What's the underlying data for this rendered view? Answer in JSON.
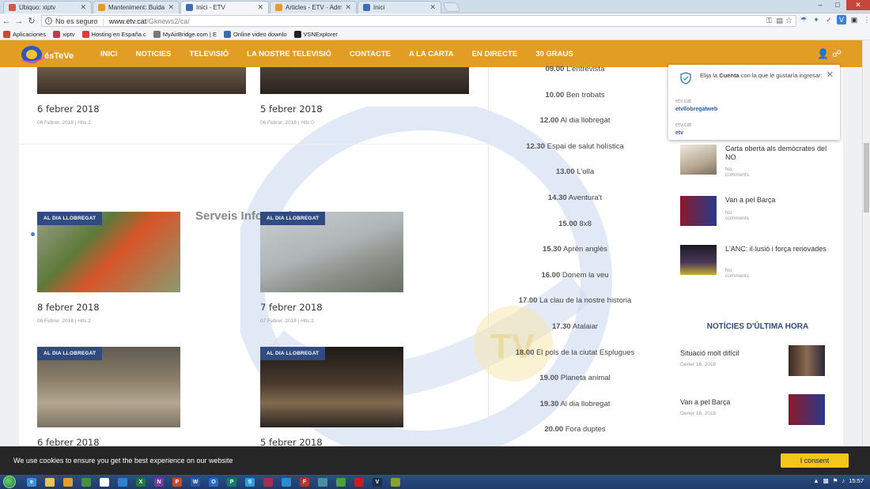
{
  "browser": {
    "tabs": [
      {
        "label": "Ubiquo: xiptv",
        "color": "#d8534a"
      },
      {
        "label": "Manteniment: Buida la m",
        "color": "#e49b2a"
      },
      {
        "label": "Inici - ETV",
        "color": "#3d6fb8",
        "active": true
      },
      {
        "label": "Articles - ETV - Administ",
        "color": "#e49b2a"
      },
      {
        "label": "Inici",
        "color": "#3d6fb8"
      }
    ],
    "security_text": "No es seguro",
    "url_host": "www.etv.cat",
    "url_path": "/Gknews2/ca/",
    "bookmarks": [
      {
        "label": "Aplicaciones",
        "icon": "apps-icon",
        "color": "#c94a3a"
      },
      {
        "label": "xiptv",
        "icon": "xiptv-icon",
        "color": "#c3374a"
      },
      {
        "label": "Hosting en España c",
        "icon": "hosting-icon",
        "color": "#d93d3d"
      },
      {
        "label": "MyAirBridge.com | E",
        "icon": "airbridge-icon",
        "color": "#777"
      },
      {
        "label": "Online video downlo",
        "icon": "video-icon",
        "color": "#3b6ea8"
      },
      {
        "label": "VSNExplorer",
        "icon": "vsn-icon",
        "color": "#222"
      }
    ]
  },
  "site": {
    "brand": "ésTeVe",
    "menu": [
      "INICI",
      "NOTICIES",
      "TELEVISIÓ",
      "LA NOSTRE TELEVISIÓ",
      "CONTACTE",
      "A LA CARTA",
      "EN DIRECTE",
      "30 GRAUS"
    ],
    "top_posts": [
      {
        "title": "6 febrer 2018",
        "meta": "06 Febrer, 2018 | Hits:2"
      },
      {
        "title": "5 febrer 2018",
        "meta": "06 Febrer, 2018 | Hits:0"
      }
    ],
    "section_title": "Serveis Informatius",
    "posts": [
      {
        "badge": "AL DIA LLOBREGAT",
        "title": "8 febrer 2018",
        "meta": "08 Febrer, 2018 | Hits:2"
      },
      {
        "badge": "AL DIA LLOBREGAT",
        "title": "7 febrer 2018",
        "meta": "07 Febrer, 2018 | Hits:2"
      },
      {
        "badge": "AL DIA LLOBREGAT",
        "title": "6 febrer 2018",
        "meta": ""
      },
      {
        "badge": "AL DIA LLOBREGAT",
        "title": "5 febrer 2018",
        "meta": ""
      }
    ],
    "schedule": [
      {
        "time": "09.00",
        "name": "L'entrevista"
      },
      {
        "time": "10.00",
        "name": "Ben trobats"
      },
      {
        "time": "12.00",
        "name": "Al dia llobregat"
      },
      {
        "time": "12.30",
        "name": "Espai de salut holística"
      },
      {
        "time": "13.00",
        "name": "L'olla"
      },
      {
        "time": "14.30",
        "name": "Aventura't"
      },
      {
        "time": "15.00",
        "name": "8x8"
      },
      {
        "time": "15.30",
        "name": "Aprèn anglès"
      },
      {
        "time": "16.00",
        "name": "Donem la veu"
      },
      {
        "time": "17.00",
        "name": "La clau de la nostre historia"
      },
      {
        "time": "17.30",
        "name": "Atalaiar"
      },
      {
        "time": "18.00",
        "name": "El pols de la ciutat Esplugues"
      },
      {
        "time": "19.00",
        "name": "Planeta animal"
      },
      {
        "time": "19.30",
        "name": "Al dia llobregat"
      },
      {
        "time": "20.00",
        "name": "Fora duptes"
      }
    ],
    "sidebar_items": [
      {
        "title": "Carta oberta als demòcrates del NO",
        "comments": "No comments"
      },
      {
        "title": "Van a pel Barça",
        "comments": "No comments"
      },
      {
        "title": "L'ANC: il·lusió i força renovades",
        "comments": "No comments"
      }
    ],
    "latest_heading": "NOTÍCIES D'ÚLTIMA HORA",
    "latest": [
      {
        "title": "Situació molt difícil",
        "date": "Gener 16, 2018"
      },
      {
        "title": "Van a pel Barça",
        "date": "Gener 16, 2018"
      }
    ]
  },
  "account_popup": {
    "text_pre": "Elija la ",
    "text_bold": "Cuenta",
    "text_post": " con la que le gustaría ingresar:",
    "accounts": [
      {
        "host": "etv.cat",
        "user": "etvllobregatweb"
      },
      {
        "host": "etv.cat",
        "user": "etv"
      }
    ]
  },
  "cookie": {
    "message": "We use cookies to ensure you get the best experience on our website",
    "button": "I consent"
  },
  "taskbar": {
    "clock": "15:57",
    "apps": [
      {
        "icon": "ie-icon",
        "color": "#3d8fd6",
        "glyph": "e"
      },
      {
        "icon": "explorer-icon",
        "color": "#e9c15a",
        "glyph": ""
      },
      {
        "icon": "media-icon",
        "color": "#e0a030",
        "glyph": ""
      },
      {
        "icon": "chrome-icon",
        "color": "#4a8f3a",
        "glyph": ""
      },
      {
        "icon": "app-icon",
        "color": "#ffffff",
        "glyph": ""
      },
      {
        "icon": "edge-icon",
        "color": "#2f7fd0",
        "glyph": ""
      },
      {
        "icon": "excel-icon",
        "color": "#1f7a3a",
        "glyph": "X"
      },
      {
        "icon": "onenote-icon",
        "color": "#7b3a9c",
        "glyph": "N"
      },
      {
        "icon": "powerpoint-icon",
        "color": "#c94a2a",
        "glyph": "P"
      },
      {
        "icon": "word-icon",
        "color": "#2b5aa8",
        "glyph": "W"
      },
      {
        "icon": "outlook-icon",
        "color": "#2a6ac2",
        "glyph": "O"
      },
      {
        "icon": "publisher-icon",
        "color": "#177a6a",
        "glyph": "P"
      },
      {
        "icon": "skype-icon",
        "color": "#2a9fe0",
        "glyph": "S"
      },
      {
        "icon": "app2-icon",
        "color": "#a03050",
        "glyph": ""
      },
      {
        "icon": "app3-icon",
        "color": "#2a8fd0",
        "glyph": ""
      },
      {
        "icon": "filezilla-icon",
        "color": "#c0302a",
        "glyph": "F"
      },
      {
        "icon": "app4-icon",
        "color": "#4a8f9f",
        "glyph": ""
      },
      {
        "icon": "app5-icon",
        "color": "#4aa03a",
        "glyph": ""
      },
      {
        "icon": "app6-icon",
        "color": "#c02020",
        "glyph": ""
      },
      {
        "icon": "vs-icon",
        "color": "#1e2e4a",
        "glyph": "V"
      },
      {
        "icon": "app7-icon",
        "color": "#8aa030",
        "glyph": ""
      }
    ]
  }
}
